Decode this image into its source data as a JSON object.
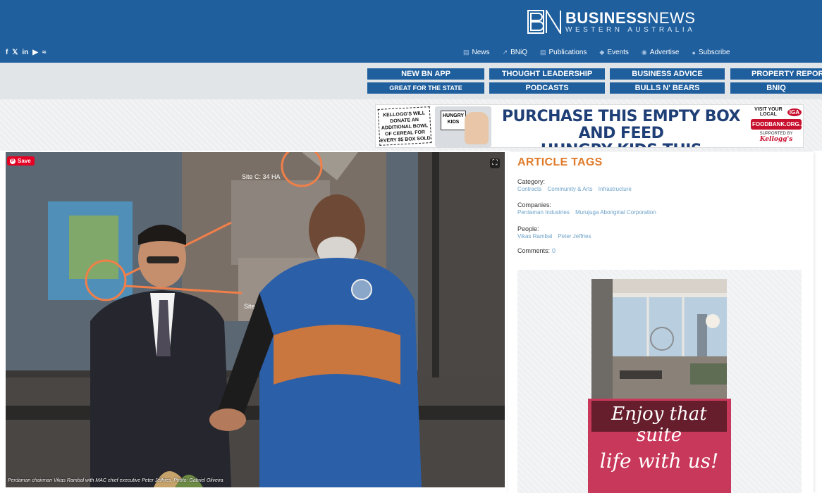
{
  "header": {
    "brand_bold": "BUSINESS",
    "brand_light": "NEWS",
    "brand_sub": "WESTERN AUSTRALIA",
    "social": [
      "f",
      "t",
      "in",
      "yt",
      "rss"
    ],
    "nav": [
      {
        "label": "News",
        "icon": "document-icon"
      },
      {
        "label": "BNiQ",
        "icon": "chart-icon"
      },
      {
        "label": "Publications",
        "icon": "book-icon"
      },
      {
        "label": "Events",
        "icon": "ticket-icon"
      },
      {
        "label": "Advertise",
        "icon": "eye-icon"
      },
      {
        "label": "Subscribe",
        "icon": "people-icon"
      }
    ]
  },
  "quick_links": {
    "row1": [
      "NEW BN APP",
      "THOUGHT LEADERSHIP",
      "BUSINESS ADVICE",
      "PROPERTY REPORT"
    ],
    "row2": [
      "GREAT FOR THE STATE",
      "PODCASTS",
      "BULLS N' BEARS",
      "BNIQ"
    ]
  },
  "banner_ad": {
    "left_text": "KELLOGG'S WILL DONATE AN ADDITIONAL BOWL OF CEREAL FOR EVERY $5 BOX SOLD",
    "box_label": "HUNGRY KIDS",
    "headline_1": "PURCHASE THIS EMPTY BOX AND FEED",
    "headline_2": "HUNGRY KIDS THIS CHRISTMAS",
    "visit": "VISIT YOUR LOCAL",
    "iga": "IGA",
    "foodbank": "FOODBANK.ORG.AU",
    "supported": "SUPPORTED BY",
    "kelloggs": "Kellogg's"
  },
  "photo": {
    "save_label": "Save",
    "caption": "Perdaman chairman Vikas Rambal with MAC chief executive Peter Jeffries. Photo: Gabriel Oliveira",
    "map_label_c": "Site C: 34 HA",
    "map_label_f": "Site F: 38"
  },
  "sidebar": {
    "title": "ARTICLE TAGS",
    "category_label": "Category:",
    "categories": [
      "Contracts",
      "Community & Arts",
      "Infrastructure"
    ],
    "companies_label": "Companies:",
    "companies": [
      "Perdaman Industries",
      "Murujuga Aboriginal Corporation"
    ],
    "people_label": "People:",
    "people": [
      "Vikas Rambal",
      "Peter Jeffries"
    ],
    "comments_label": "Comments:",
    "comments_count": "0"
  },
  "side_ad": {
    "line1": "Enjoy that suite",
    "line2": "life with us!"
  },
  "colors": {
    "brand_blue": "#1f5f9e",
    "tag_orange": "#e07b2a",
    "link_blue": "#6da2c9",
    "pinterest_red": "#e60023",
    "ad_pink": "#c8385a"
  }
}
